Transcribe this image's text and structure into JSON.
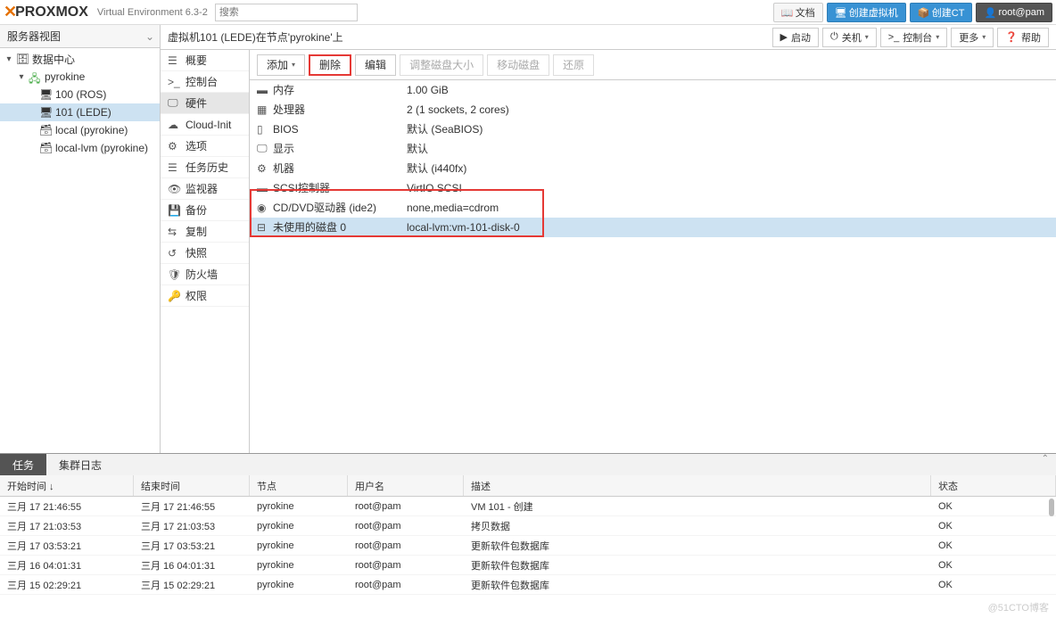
{
  "topbar": {
    "logo_text": "PROXMOX",
    "ve_label": "Virtual Environment 6.3-2",
    "search_placeholder": "搜索",
    "doc": "文档",
    "create_vm": "创建虚拟机",
    "create_ct": "创建CT",
    "user": "root@pam"
  },
  "sidebar": {
    "view_label": "服务器视图",
    "nodes": {
      "datacenter": "数据中心",
      "pyrokine": "pyrokine",
      "vm100": "100 (ROS)",
      "vm101": "101 (LEDE)",
      "local": "local (pyrokine)",
      "locallvm": "local-lvm (pyrokine)"
    }
  },
  "content": {
    "title": "虚拟机101 (LEDE)在节点'pyrokine'上",
    "actions": {
      "start": "启动",
      "shutdown": "关机",
      "console": "控制台",
      "more": "更多",
      "help": "帮助"
    }
  },
  "subtabs": {
    "summary": "概要",
    "console": "控制台",
    "hardware": "硬件",
    "cloudinit": "Cloud-Init",
    "options": "选项",
    "taskhistory": "任务历史",
    "monitor": "监视器",
    "backup": "备份",
    "replication": "复制",
    "snapshots": "快照",
    "firewall": "防火墙",
    "permissions": "权限"
  },
  "hw_toolbar": {
    "add": "添加",
    "remove": "删除",
    "edit": "编辑",
    "resize": "调整磁盘大小",
    "move": "移动磁盘",
    "revert": "还原"
  },
  "hw_rows": [
    {
      "icon": "memory",
      "key": "内存",
      "val": "1.00 GiB"
    },
    {
      "icon": "cpu",
      "key": "处理器",
      "val": "2 (1 sockets, 2 cores)"
    },
    {
      "icon": "bios",
      "key": "BIOS",
      "val": "默认 (SeaBIOS)"
    },
    {
      "icon": "display",
      "key": "显示",
      "val": "默认"
    },
    {
      "icon": "machine",
      "key": "机器",
      "val": "默认 (i440fx)"
    },
    {
      "icon": "scsi",
      "key": "SCSI控制器",
      "val": "VirtIO SCSI"
    },
    {
      "icon": "cdrom",
      "key": "CD/DVD驱动器 (ide2)",
      "val": "none,media=cdrom"
    },
    {
      "icon": "disk",
      "key": "未使用的磁盘 0",
      "val": "local-lvm:vm-101-disk-0"
    }
  ],
  "bottom_tabs": {
    "tasks": "任务",
    "cluster_log": "集群日志"
  },
  "log_headers": {
    "start": "开始时间 ↓",
    "end": "结束时间",
    "node": "节点",
    "user": "用户名",
    "desc": "描述",
    "status": "状态"
  },
  "log_rows": [
    {
      "start": "三月 17 21:46:55",
      "end": "三月 17 21:46:55",
      "node": "pyrokine",
      "user": "root@pam",
      "desc": "VM 101 - 创建",
      "status": "OK"
    },
    {
      "start": "三月 17 21:03:53",
      "end": "三月 17 21:03:53",
      "node": "pyrokine",
      "user": "root@pam",
      "desc": "拷贝数据",
      "status": "OK"
    },
    {
      "start": "三月 17 03:53:21",
      "end": "三月 17 03:53:21",
      "node": "pyrokine",
      "user": "root@pam",
      "desc": "更新软件包数据库",
      "status": "OK"
    },
    {
      "start": "三月 16 04:01:31",
      "end": "三月 16 04:01:31",
      "node": "pyrokine",
      "user": "root@pam",
      "desc": "更新软件包数据库",
      "status": "OK"
    },
    {
      "start": "三月 15 02:29:21",
      "end": "三月 15 02:29:21",
      "node": "pyrokine",
      "user": "root@pam",
      "desc": "更新软件包数据库",
      "status": "OK"
    }
  ],
  "watermark": "@51CTO博客"
}
